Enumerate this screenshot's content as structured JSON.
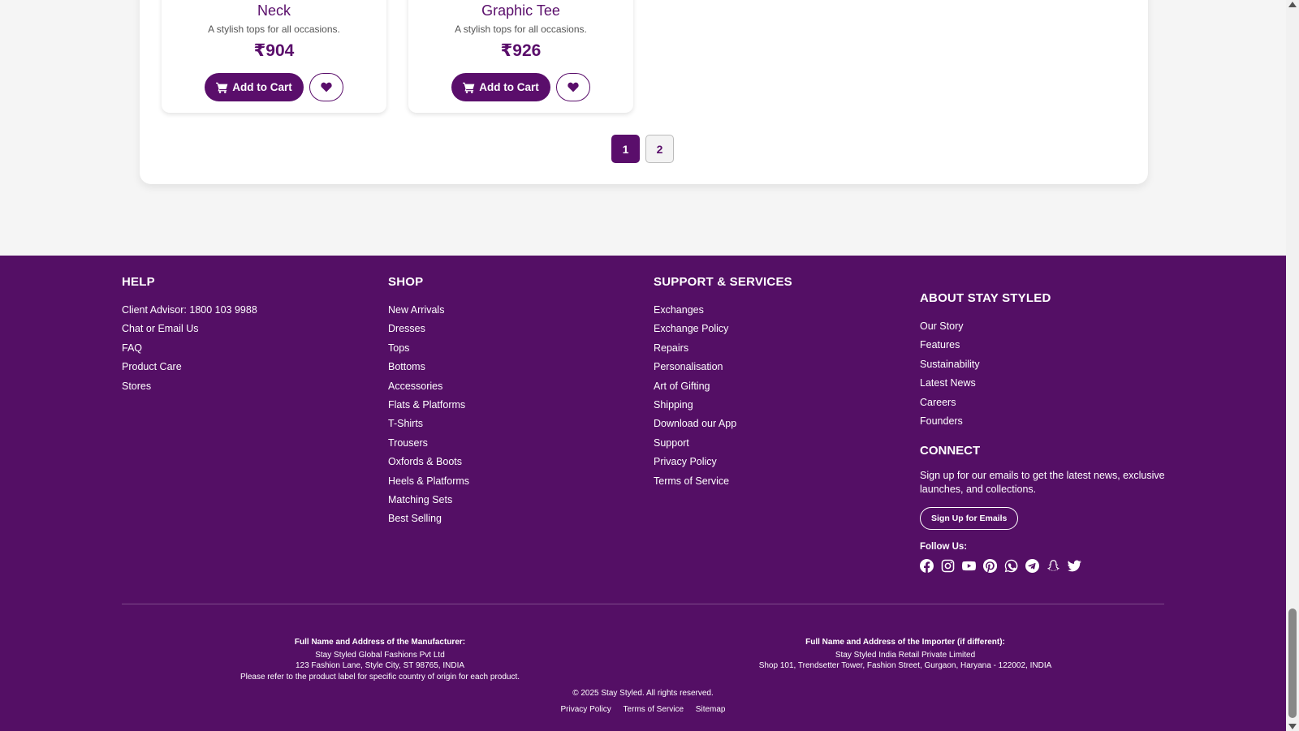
{
  "products": [
    {
      "title": "Neck",
      "description": "A stylish tops for all occasions.",
      "price": "₹904",
      "cart_label": "Add to Cart"
    },
    {
      "title": "Graphic Tee",
      "description": "A stylish tops for all occasions.",
      "price": "₹926",
      "cart_label": "Add to Cart"
    }
  ],
  "pagination": {
    "pages": [
      "1",
      "2"
    ],
    "active": "1"
  },
  "footer": {
    "help": {
      "title": "HELP",
      "items": [
        "Client Advisor: 1800 103 9988",
        "Chat or Email Us",
        "FAQ",
        "Product Care",
        "Stores"
      ]
    },
    "shop": {
      "title": "SHOP",
      "items": [
        "New Arrivals",
        "Dresses",
        "Tops",
        "Bottoms",
        "Accessories",
        "Flats & Platforms",
        "T-Shirts",
        "Trousers",
        "Oxfords & Boots",
        "Heels & Platforms",
        "Matching Sets",
        "Best Selling"
      ]
    },
    "support": {
      "title": "SUPPORT & SERVICES",
      "items": [
        "Exchanges",
        "Exchange Policy",
        "Repairs",
        "Personalisation",
        "Art of Gifting",
        "Shipping",
        "Download our App",
        "Support",
        "Privacy Policy",
        "Terms of Service"
      ]
    },
    "about": {
      "title": "ABOUT STAY STYLED",
      "items": [
        "Our Story",
        "Features",
        "Sustainability",
        "Latest News",
        "Careers",
        "Founders"
      ]
    },
    "connect": {
      "title": "CONNECT",
      "text": "Sign up for our emails to get the latest news, exclusive launches, and collections.",
      "signup_label": "Sign Up for Emails",
      "follow_label": "Follow Us:",
      "socials": [
        "facebook-icon",
        "instagram-icon",
        "youtube-icon",
        "pinterest-icon",
        "whatsapp-icon",
        "telegram-icon",
        "snapchat-icon",
        "twitter-icon"
      ]
    },
    "manufacturer": {
      "label": "Full Name and Address of the Manufacturer:",
      "name": "Stay Styled Global Fashions Pvt Ltd",
      "address": "123 Fashion Lane, Style City, ST 98765, INDIA",
      "note": "Please refer to the product label for specific country of origin for each product."
    },
    "importer": {
      "label": "Full Name and Address of the Importer (if different):",
      "name": "Stay Styled India Retail Private Limited",
      "address": "Shop 101, Trendsetter Tower, Fashion Street, Gurgaon, Haryana - 122002, INDIA"
    },
    "copyright": "© 2025 Stay Styled. All rights reserved.",
    "bottom_links": [
      "Privacy Policy",
      "Terms of Service",
      "Sitemap"
    ]
  },
  "colors": {
    "brand": "#540f65",
    "accent": "#5a0e6b"
  }
}
